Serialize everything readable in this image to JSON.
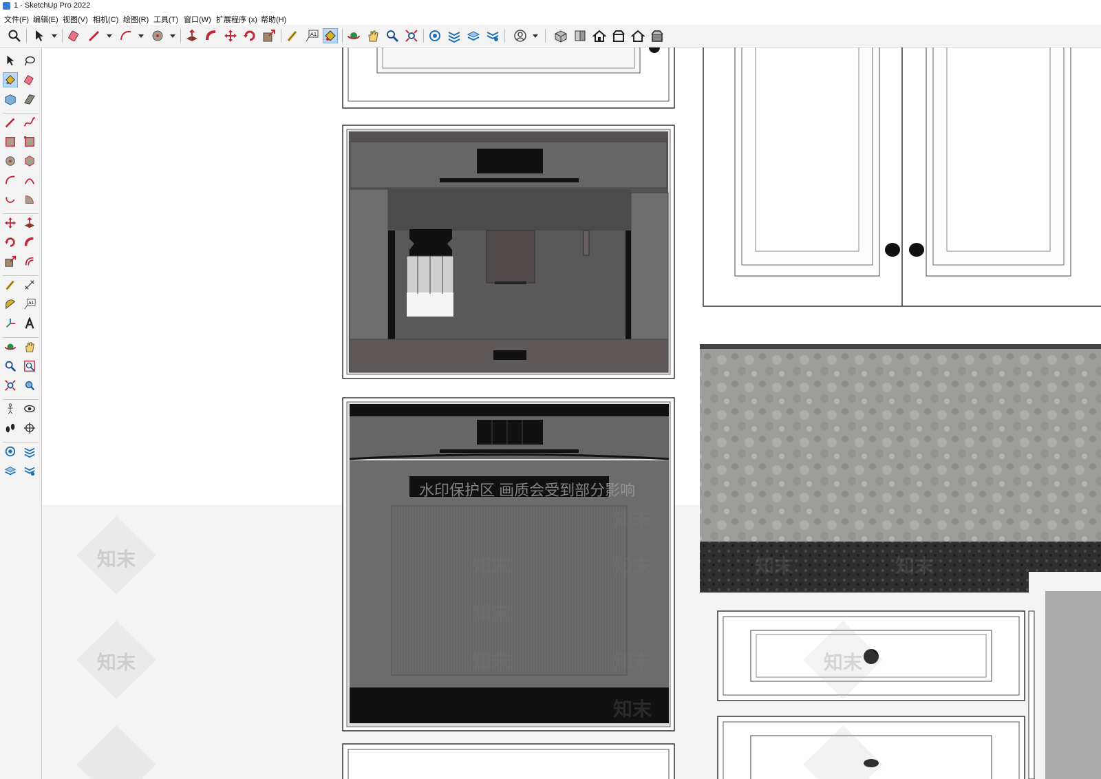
{
  "window": {
    "title": "1 - SketchUp Pro 2022"
  },
  "menu": [
    "文件(F)",
    "编辑(E)",
    "视图(V)",
    "相机(C)",
    "绘图(R)",
    "工具(T)",
    "窗口(W)",
    "扩展程序 (x)",
    "帮助(H)"
  ],
  "toolbar_icons": [
    "zoom-icon",
    "select-icon",
    "eraser-icon",
    "line-icon",
    "arc-icon",
    "circle-icon",
    "push-pull-icon",
    "follow-me-icon",
    "move-icon",
    "rotate-icon",
    "scale-icon",
    "tape-measure-icon",
    "text-icon",
    "paint-bucket-icon",
    "orbit-icon",
    "pan-icon",
    "zoom-window-icon",
    "zoom-extents-icon",
    "warehouse-icon",
    "extension-warehouse-icon",
    "layout-icon",
    "style-icon",
    "account-icon",
    "iso-view-icon",
    "top-view-icon",
    "front-view-icon",
    "right-view-icon",
    "back-view-icon",
    "left-view-icon"
  ],
  "viewport": {
    "watermark_banner": "水印保护区   画质会受到部分影响",
    "watermark_tile": "知末",
    "colors": {
      "countertop": "#9c9c9c",
      "appliance": "#6a6a6a",
      "cabinet": "#ffffff",
      "edge": "#333333"
    }
  }
}
